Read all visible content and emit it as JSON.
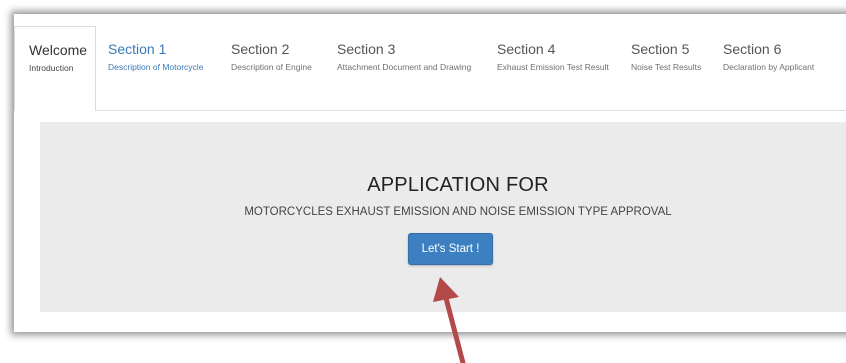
{
  "tabs": [
    {
      "title": "Welcome",
      "subtitle": "Introduction"
    },
    {
      "title": "Section 1",
      "subtitle": "Description of Motorcycle"
    },
    {
      "title": "Section 2",
      "subtitle": "Description of Engine"
    },
    {
      "title": "Section 3",
      "subtitle": "Attachment Document and Drawing"
    },
    {
      "title": "Section 4",
      "subtitle": "Exhaust Emission Test Result"
    },
    {
      "title": "Section 5",
      "subtitle": "Noise Test Results"
    },
    {
      "title": "Section 6",
      "subtitle": "Declaration by Applicant"
    }
  ],
  "panel": {
    "heading": "APPLICATION FOR",
    "subheading": "MOTORCYCLES EXHAUST EMISSION AND NOISE EMISSION TYPE APPROVAL",
    "start_label": "Let's Start !"
  },
  "colors": {
    "accent": "#3c80c2",
    "link": "#3a79b7",
    "panel_bg": "#ebebeb",
    "arrow": "#b24a4a"
  }
}
